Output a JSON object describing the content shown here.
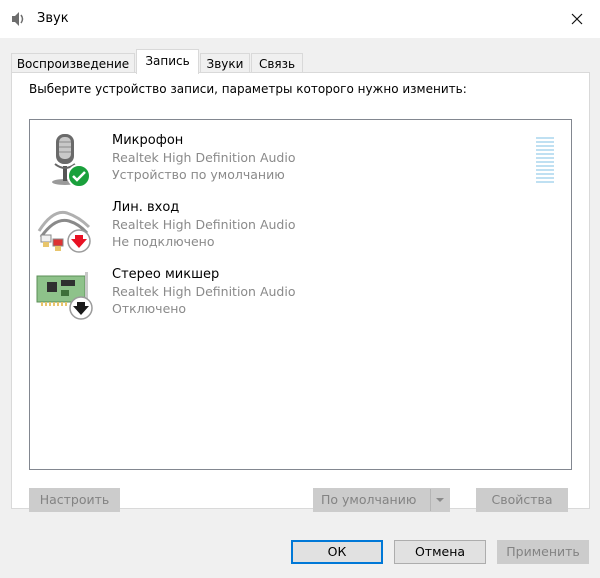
{
  "window": {
    "title": "Звук",
    "icon": "speaker-icon",
    "close": "close-icon"
  },
  "tabs": [
    {
      "label": "Воспроизведение",
      "active": false
    },
    {
      "label": "Запись",
      "active": true
    },
    {
      "label": "Звуки",
      "active": false
    },
    {
      "label": "Связь",
      "active": false
    }
  ],
  "panel": {
    "instruction": "Выберите устройство записи, параметры которого нужно изменить:",
    "devices": [
      {
        "name": "Микрофон",
        "driver": "Realtek High Definition Audio",
        "status": "Устройство по умолчанию",
        "icon": "microphone-icon",
        "badge": "check-badge-icon"
      },
      {
        "name": "Лин. вход",
        "driver": "Realtek High Definition Audio",
        "status": "Не подключено",
        "icon": "line-in-cable-icon",
        "badge": "red-down-arrow-badge-icon"
      },
      {
        "name": "Стерео микшер",
        "driver": "Realtek High Definition Audio",
        "status": "Отключено",
        "icon": "sound-card-icon",
        "badge": "black-down-arrow-badge-icon"
      }
    ],
    "buttons": {
      "configure": "Настроить",
      "set_default": "По умолчанию",
      "properties": "Свойства"
    }
  },
  "footer": {
    "ok": "ОК",
    "cancel": "Отмена",
    "apply": "Применить"
  },
  "colors": {
    "accent": "#0078d7",
    "check": "#1aa03c",
    "arrow_red": "#e81123"
  }
}
